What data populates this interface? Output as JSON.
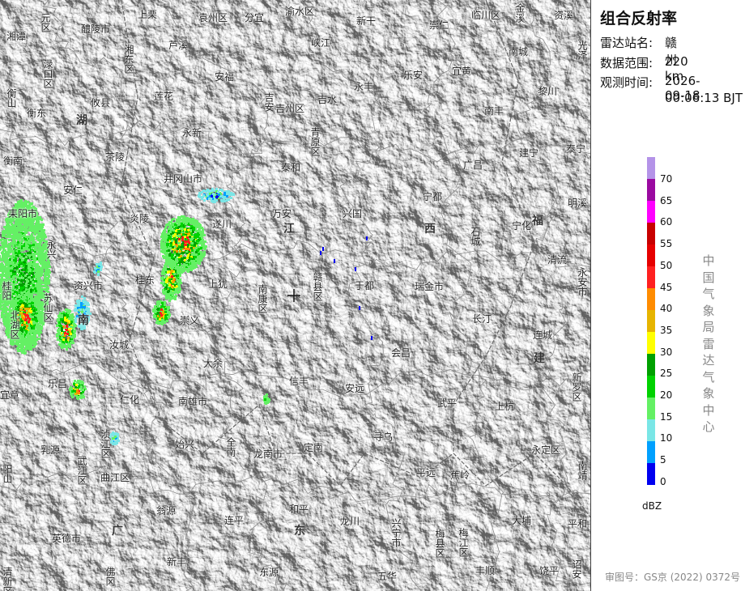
{
  "panel": {
    "title": "组合反射率",
    "station_label": "雷达站名:",
    "station_value": "赣州",
    "range_label": "数据范围:",
    "range_value": "220 km",
    "time_label": "观测时间:",
    "time_date": "2026-09-18",
    "time_clock": "00:06:13 BJT",
    "unit": "dBZ",
    "organization": "中国气象局雷达气象中心",
    "approval": "审图号：GS京 (2022) 0372号"
  },
  "legend": {
    "ticks": [
      "70",
      "65",
      "60",
      "55",
      "50",
      "45",
      "40",
      "35",
      "30",
      "25",
      "20",
      "15",
      "10",
      "5",
      "0"
    ],
    "colors": [
      "#b493e8",
      "#9a0aa0",
      "#ff00ff",
      "#c80000",
      "#e60000",
      "#ff2020",
      "#ff8c00",
      "#e6b400",
      "#ffff00",
      "#00a000",
      "#00d200",
      "#64f064",
      "#7ae6e6",
      "#00a0ff",
      "#0000f0"
    ]
  },
  "provinces": [
    "湖",
    "南",
    "江",
    "西",
    "福",
    "建",
    "广",
    "东"
  ],
  "places": [
    {
      "t": "醴陵市"
    },
    {
      "t": "上栗"
    },
    {
      "t": "袁州区"
    },
    {
      "t": "分宜"
    },
    {
      "t": "渝水区"
    },
    {
      "t": "新干"
    },
    {
      "t": "崇仁"
    },
    {
      "t": "临川区"
    },
    {
      "t": "资溪"
    },
    {
      "t": "湘潭"
    },
    {
      "t": "芦溪"
    },
    {
      "t": "峡江"
    },
    {
      "t": "南城"
    },
    {
      "t": "安福"
    },
    {
      "t": "永丰"
    },
    {
      "t": "乐安"
    },
    {
      "t": "宜黄"
    },
    {
      "t": "黎川"
    },
    {
      "t": "衡东"
    },
    {
      "t": "攸县"
    },
    {
      "t": "莲花"
    },
    {
      "t": "吉州区"
    },
    {
      "t": "吉水"
    },
    {
      "t": "南丰"
    },
    {
      "t": "永新"
    },
    {
      "t": "衡南"
    },
    {
      "t": "茶陵"
    },
    {
      "t": "泰和"
    },
    {
      "t": "广昌"
    },
    {
      "t": "建宁"
    },
    {
      "t": "泰宁"
    },
    {
      "t": "井冈山市"
    },
    {
      "t": "安仁"
    },
    {
      "t": "宁都"
    },
    {
      "t": "明溪"
    },
    {
      "t": "耒阳市"
    },
    {
      "t": "炎陵"
    },
    {
      "t": "遂川"
    },
    {
      "t": "万安"
    },
    {
      "t": "兴国"
    },
    {
      "t": "宁化"
    },
    {
      "t": "清流"
    },
    {
      "t": "资兴市"
    },
    {
      "t": "桂东"
    },
    {
      "t": "上犹"
    },
    {
      "t": "于都"
    },
    {
      "t": "瑞金市"
    },
    {
      "t": "长汀"
    },
    {
      "t": "崇义"
    },
    {
      "t": "汝城"
    },
    {
      "t": "连城"
    },
    {
      "t": "大余"
    },
    {
      "t": "会昌"
    },
    {
      "t": "信丰"
    },
    {
      "t": "安远"
    },
    {
      "t": "宜章"
    },
    {
      "t": "乐昌"
    },
    {
      "t": "仁化"
    },
    {
      "t": "南雄市"
    },
    {
      "t": "武平"
    },
    {
      "t": "上杭"
    },
    {
      "t": "乳源"
    },
    {
      "t": "始兴"
    },
    {
      "t": "定南"
    },
    {
      "t": "寻乌"
    },
    {
      "t": "龙南市"
    },
    {
      "t": "永定区"
    },
    {
      "t": "曲江区"
    },
    {
      "t": "平远"
    },
    {
      "t": "蕉岭"
    },
    {
      "t": "翁源"
    },
    {
      "t": "连平"
    },
    {
      "t": "和平"
    },
    {
      "t": "大埔"
    },
    {
      "t": "英德市"
    },
    {
      "t": "龙川"
    },
    {
      "t": "平和"
    },
    {
      "t": "新丰"
    },
    {
      "t": "东源"
    },
    {
      "t": "五华"
    },
    {
      "t": "丰顺"
    },
    {
      "t": "饶平"
    },
    {
      "t": "吉安"
    },
    {
      "t": "南康区"
    },
    {
      "t": "青原区"
    },
    {
      "t": "元区"
    },
    {
      "t": "湘东区"
    },
    {
      "t": "渌口区"
    },
    {
      "t": "衡山"
    },
    {
      "t": "苏仙区"
    },
    {
      "t": "北湖区"
    },
    {
      "t": "永兴"
    },
    {
      "t": "桂阳"
    },
    {
      "t": "赣县区"
    },
    {
      "t": "石城"
    },
    {
      "t": "光泽"
    },
    {
      "t": "永安市"
    },
    {
      "t": "新罗区"
    },
    {
      "t": "南靖"
    },
    {
      "t": "诏安"
    },
    {
      "t": "金溪"
    },
    {
      "t": "全南"
    },
    {
      "t": "兴宁市"
    },
    {
      "t": "梅县区"
    },
    {
      "t": "梅江区"
    },
    {
      "t": "浈江区"
    },
    {
      "t": "武江区"
    },
    {
      "t": "阳山"
    },
    {
      "t": "清新区"
    },
    {
      "t": "佛冈"
    }
  ]
}
